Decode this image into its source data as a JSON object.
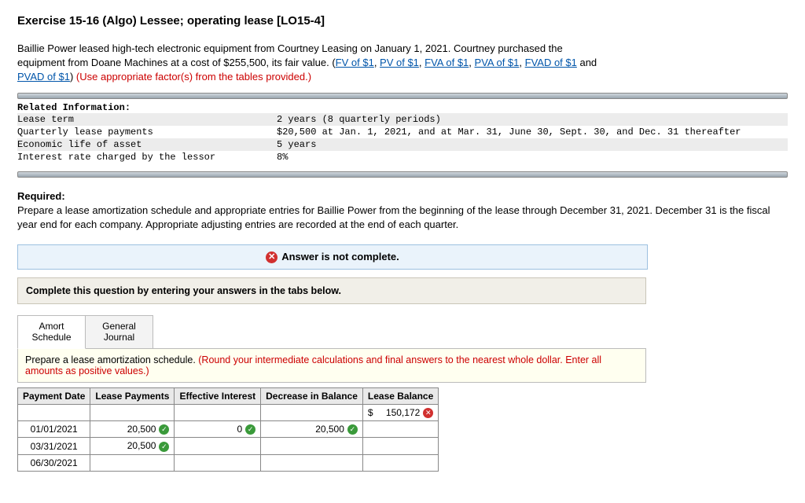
{
  "title": "Exercise 15-16 (Algo) Lessee; operating lease [LO15-4]",
  "intro": {
    "line1a": "Baillie Power leased high-tech electronic equipment from Courtney Leasing on January 1, 2021. Courtney purchased the",
    "line1b": "equipment from Doane Machines at a cost of $255,500, its fair value. (",
    "links": {
      "fv": "FV of $1",
      "pv": "PV of $1",
      "fva": "FVA of $1",
      "pva": "PVA of $1",
      "fvad": "FVAD of $1",
      "pvad": "PVAD of $1"
    },
    "and": " and ",
    "line2": ") ",
    "note": "(Use appropriate factor(s) from the tables provided.)"
  },
  "info_header": "Related Information:",
  "info": [
    {
      "label": "Lease term",
      "value": "2 years (8 quarterly periods)"
    },
    {
      "label": "Quarterly lease payments",
      "value": "$20,500 at Jan. 1, 2021, and at Mar. 31, June 30, Sept. 30, and Dec. 31 thereafter"
    },
    {
      "label": "Economic life of asset",
      "value": "5 years"
    },
    {
      "label": "Interest rate charged by the lessor",
      "value": "8%"
    }
  ],
  "required_hdr": "Required:",
  "required_text": "Prepare a lease amortization schedule and appropriate entries for Baillie Power from the beginning of the lease through December 31, 2021. December 31 is the fiscal year end for each company. Appropriate adjusting entries are recorded at the end of each quarter.",
  "status": "Answer is not complete.",
  "instr": "Complete this question by entering your answers in the tabs below.",
  "tabs": {
    "amort": "Amort Schedule",
    "journal": "General Journal"
  },
  "panel": {
    "text": "Prepare a lease amortization schedule. ",
    "hint": "(Round your intermediate calculations and final answers to the nearest whole dollar. Enter all amounts as positive values.)"
  },
  "sched": {
    "headers": [
      "Payment Date",
      "Lease Payments",
      "Effective Interest",
      "Decrease in Balance",
      "Lease Balance"
    ],
    "opening_balance": "150,172",
    "rows": [
      {
        "date": "01/01/2021",
        "pay": "20,500",
        "pay_ok": true,
        "int": "0",
        "int_ok": true,
        "dec": "20,500",
        "dec_ok": true,
        "bal": ""
      },
      {
        "date": "03/31/2021",
        "pay": "20,500",
        "pay_ok": true,
        "int": "",
        "dec": "",
        "bal": ""
      },
      {
        "date": "06/30/2021",
        "pay": "",
        "int": "",
        "dec": "",
        "bal": ""
      }
    ]
  }
}
